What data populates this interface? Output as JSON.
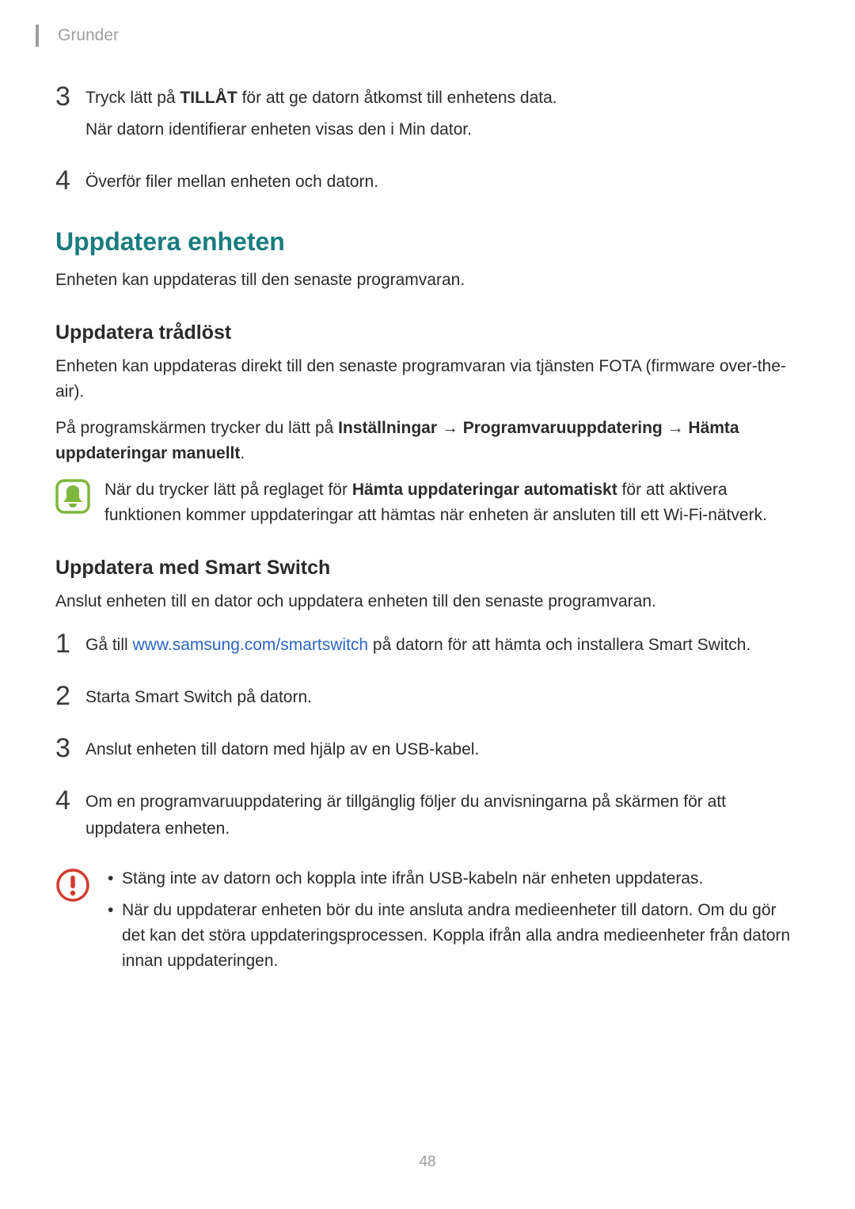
{
  "header": {
    "section_label": "Grunder"
  },
  "top_steps": {
    "item3": {
      "num": "3",
      "line1_a": "Tryck lätt på ",
      "line1_b": "TILLÅT",
      "line1_c": " för att ge datorn åtkomst till enhetens data.",
      "line2": "När datorn identifierar enheten visas den i Min dator."
    },
    "item4": {
      "num": "4",
      "line1": "Överför filer mellan enheten och datorn."
    }
  },
  "section1": {
    "heading": "Uppdatera enheten",
    "intro": "Enheten kan uppdateras till den senaste programvaran."
  },
  "sub1": {
    "heading": "Uppdatera trådlöst",
    "p1": "Enheten kan uppdateras direkt till den senaste programvaran via tjänsten FOTA (firmware over-the-air).",
    "p2_a": "På programskärmen trycker du lätt på ",
    "p2_b": "Inställningar",
    "p2_arrow1": " → ",
    "p2_c": "Programvaruuppdatering",
    "p2_arrow2": " → ",
    "p2_d": "Hämta uppdateringar manuellt",
    "p2_e": ".",
    "note_a": "När du trycker lätt på reglaget för ",
    "note_b": "Hämta uppdateringar automatiskt",
    "note_c": " för att aktivera funktionen kommer uppdateringar att hämtas när enheten är ansluten till ett Wi-Fi-nätverk."
  },
  "sub2": {
    "heading": "Uppdatera med Smart Switch",
    "intro": "Anslut enheten till en dator och uppdatera enheten till den senaste programvaran.",
    "step1": {
      "num": "1",
      "a": "Gå till ",
      "link": "www.samsung.com/smartswitch",
      "b": " på datorn för att hämta och installera Smart Switch."
    },
    "step2": {
      "num": "2",
      "text": "Starta Smart Switch på datorn."
    },
    "step3": {
      "num": "3",
      "text": "Anslut enheten till datorn med hjälp av en USB-kabel."
    },
    "step4": {
      "num": "4",
      "text": "Om en programvaruuppdatering är tillgänglig följer du anvisningarna på skärmen för att uppdatera enheten."
    },
    "warn_bullet1": "Stäng inte av datorn och koppla inte ifrån USB-kabeln när enheten uppdateras.",
    "warn_bullet2": "När du uppdaterar enheten bör du inte ansluta andra medieenheter till datorn. Om du gör det kan det störa uppdateringsprocessen. Koppla ifrån alla andra medieenheter från datorn innan uppdateringen."
  },
  "link_url": "www.samsung.com/smartswitch",
  "page_number": "48"
}
